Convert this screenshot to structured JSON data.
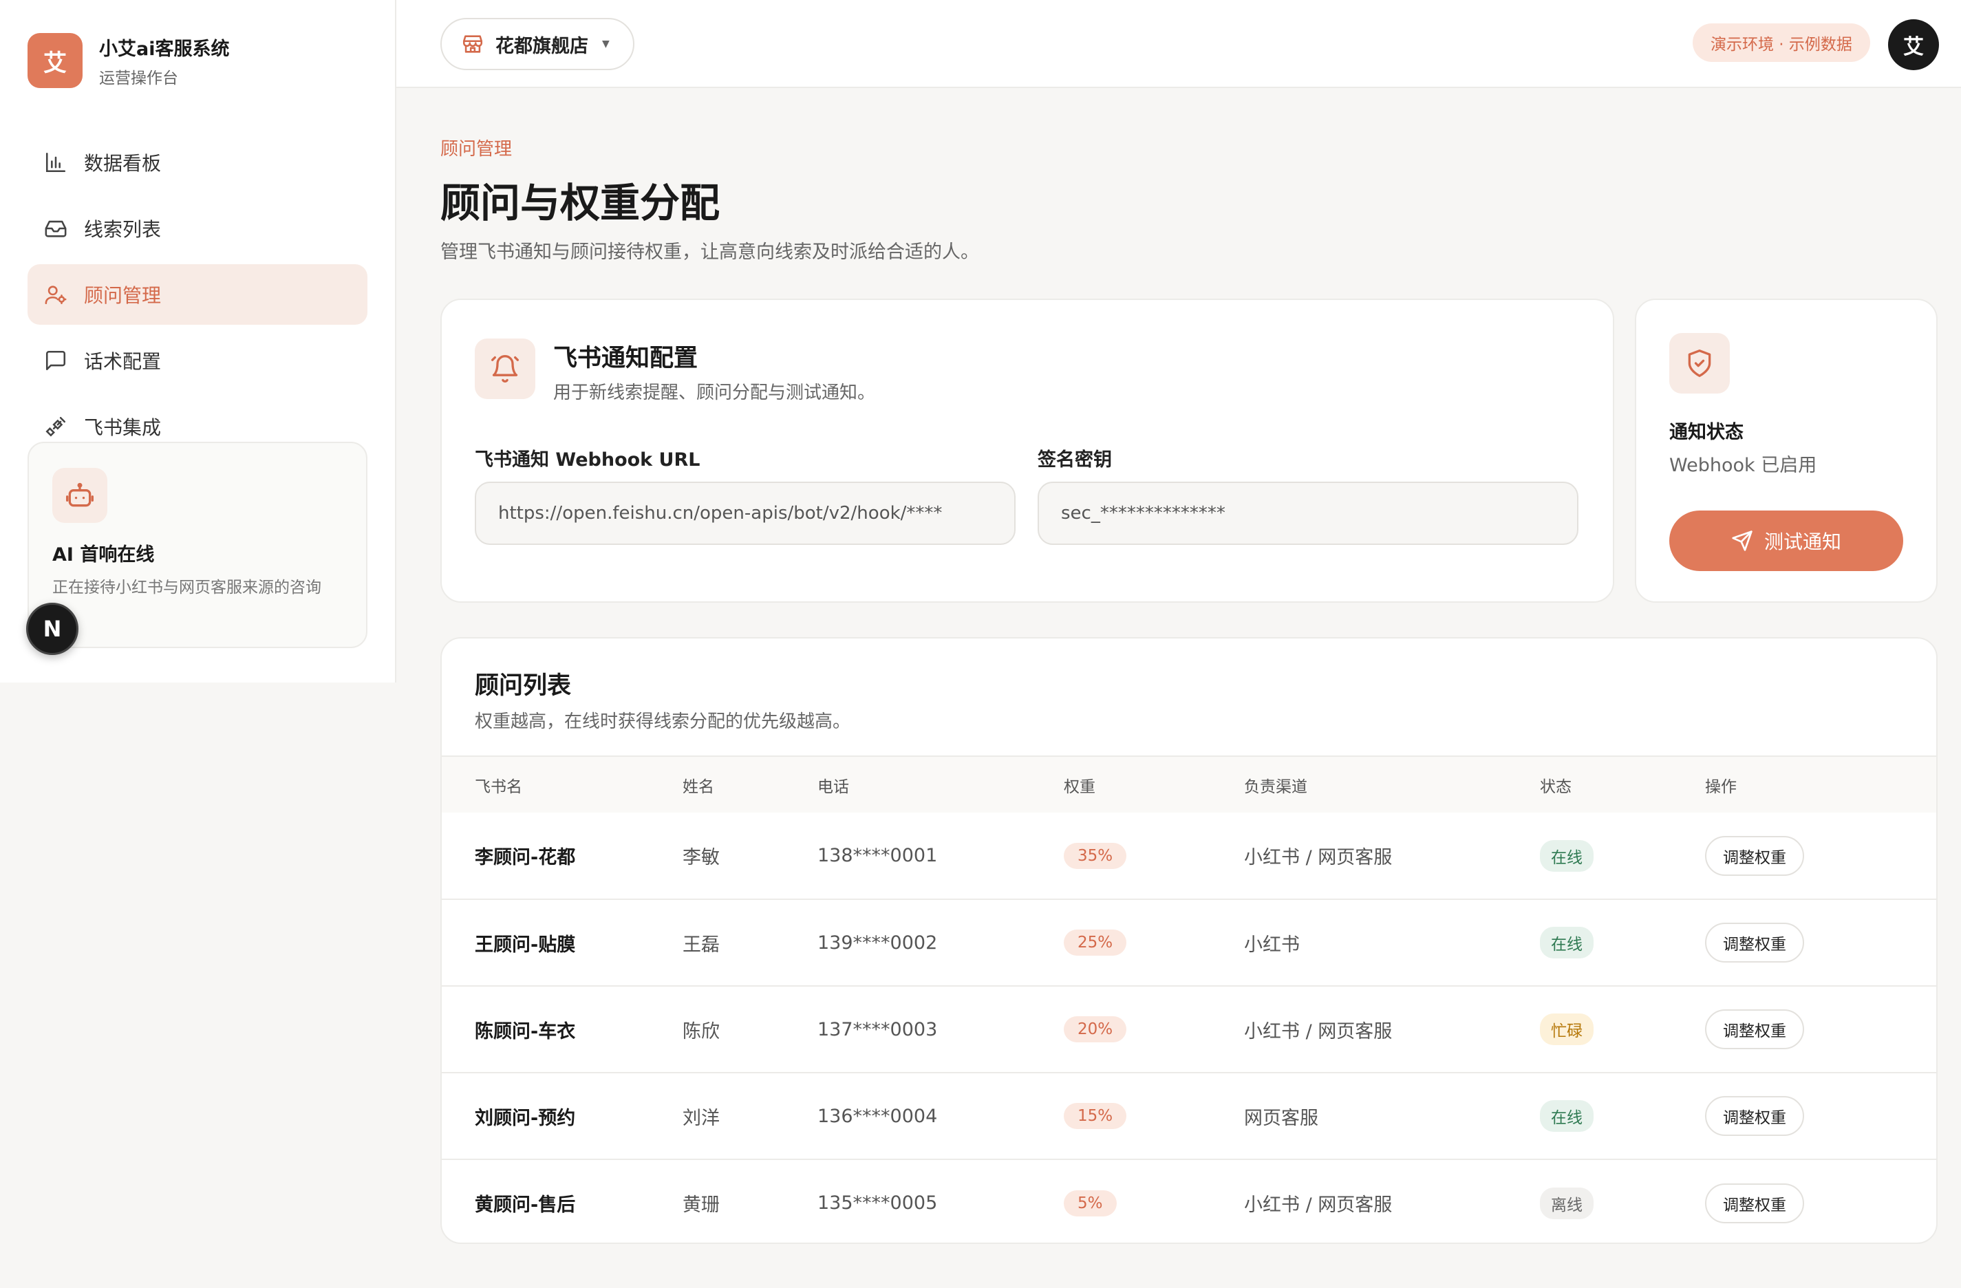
{
  "brand": {
    "logo_char": "艾",
    "title": "小艾ai客服系统",
    "subtitle": "运营操作台"
  },
  "nav": [
    {
      "label": "数据看板",
      "icon": "bar-chart-icon",
      "active": false
    },
    {
      "label": "线索列表",
      "icon": "inbox-icon",
      "active": false
    },
    {
      "label": "顾问管理",
      "icon": "user-settings-icon",
      "active": true
    },
    {
      "label": "话术配置",
      "icon": "message-square-icon",
      "active": false
    },
    {
      "label": "飞书集成",
      "icon": "plug-icon",
      "active": false
    }
  ],
  "ai_card": {
    "title": "AI 首响在线",
    "subtitle": "正在接待小红书与网页客服来源的咨询"
  },
  "next_badge": "N",
  "topbar": {
    "store": "花都旗舰店",
    "demo_badge": "演示环境 · 示例数据",
    "avatar": "艾"
  },
  "page": {
    "breadcrumb": "顾问管理",
    "title": "顾问与权重分配",
    "description": "管理飞书通知与顾问接待权重，让高意向线索及时派给合适的人。"
  },
  "notify": {
    "title": "飞书通知配置",
    "subtitle": "用于新线索提醒、顾问分配与测试通知。",
    "webhook_label": "飞书通知 Webhook URL",
    "webhook_value": "https://open.feishu.cn/open-apis/bot/v2/hook/****",
    "secret_label": "签名密钥",
    "secret_value": "sec_**************"
  },
  "status_card": {
    "title": "通知状态",
    "value": "Webhook 已启用",
    "button": "测试通知"
  },
  "advisors": {
    "title": "顾问列表",
    "subtitle": "权重越高，在线时获得线索分配的优先级越高。",
    "headers": [
      "飞书名",
      "姓名",
      "电话",
      "权重",
      "负责渠道",
      "状态",
      "操作"
    ],
    "rows": [
      {
        "feishu": "李顾问-花都",
        "name": "李敏",
        "phone": "138****0001",
        "weight": "35%",
        "channel": "小红书 / 网页客服",
        "status": "在线",
        "status_kind": "online",
        "action": "调整权重"
      },
      {
        "feishu": "王顾问-贴膜",
        "name": "王磊",
        "phone": "139****0002",
        "weight": "25%",
        "channel": "小红书",
        "status": "在线",
        "status_kind": "online",
        "action": "调整权重"
      },
      {
        "feishu": "陈顾问-车衣",
        "name": "陈欣",
        "phone": "137****0003",
        "weight": "20%",
        "channel": "小红书 / 网页客服",
        "status": "忙碌",
        "status_kind": "busy",
        "action": "调整权重"
      },
      {
        "feishu": "刘顾问-预约",
        "name": "刘洋",
        "phone": "136****0004",
        "weight": "15%",
        "channel": "网页客服",
        "status": "在线",
        "status_kind": "online",
        "action": "调整权重"
      },
      {
        "feishu": "黄顾问-售后",
        "name": "黄珊",
        "phone": "135****0005",
        "weight": "5%",
        "channel": "小红书 / 网页客服",
        "status": "离线",
        "status_kind": "offline",
        "action": "调整权重"
      }
    ]
  },
  "colors": {
    "accent": "#e07a5a",
    "accent_text": "#d4694a",
    "accent_soft": "#f8ebe5"
  }
}
